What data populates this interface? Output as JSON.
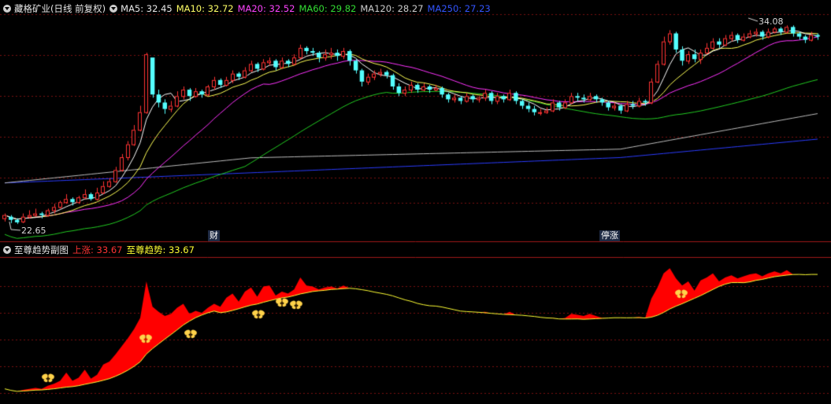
{
  "main_header": {
    "title": "藏格矿业(日线 前复权)",
    "ma": [
      {
        "label": "MA5: 32.45",
        "color": "#e8e8e8"
      },
      {
        "label": "MA10: 32.72",
        "color": "#ffff66"
      },
      {
        "label": "MA20: 32.52",
        "color": "#ff44ff"
      },
      {
        "label": "MA60: 29.82",
        "color": "#33dd33"
      },
      {
        "label": "MA120: 28.27",
        "color": "#cccccc"
      },
      {
        "label": "MA250: 27.23",
        "color": "#3355ff"
      }
    ]
  },
  "annotations": {
    "high_label": "34.08",
    "low_label": "22.65",
    "event_cai": "财",
    "event_tingzhang": "停涨"
  },
  "sub_header": {
    "title": "至尊趋势副图",
    "items": [
      {
        "label": "上涨: 33.67",
        "color": "#ff3333"
      },
      {
        "label": "至尊趋势: 33.67",
        "color": "#ffff33"
      }
    ]
  },
  "colors": {
    "up": "#ff3333",
    "down": "#54ffff",
    "grid": "#7a1010",
    "trend_fill": "#ff0000",
    "trend_line": "#ffff33",
    "butterfly": "#ffd24a"
  },
  "chart_data": {
    "type": "candlestick",
    "ohlc_note": "approximate daily prices read from the chart, open/close/high/low",
    "candles": [
      [
        23.0,
        23.2,
        23.3,
        22.8
      ],
      [
        23.1,
        22.9,
        23.2,
        22.7
      ],
      [
        22.9,
        22.75,
        23.0,
        22.65
      ],
      [
        22.8,
        23.1,
        23.3,
        22.7
      ],
      [
        23.1,
        23.2,
        23.5,
        23.0
      ],
      [
        23.2,
        23.3,
        23.6,
        23.1
      ],
      [
        23.3,
        23.2,
        23.4,
        23.0
      ],
      [
        23.2,
        23.5,
        23.6,
        23.1
      ],
      [
        23.5,
        23.7,
        23.9,
        23.3
      ],
      [
        23.7,
        24.0,
        24.1,
        23.6
      ],
      [
        24.0,
        24.2,
        24.5,
        23.9
      ],
      [
        24.2,
        24.0,
        24.3,
        23.8
      ],
      [
        24.0,
        24.3,
        24.4,
        23.9
      ],
      [
        24.3,
        24.5,
        24.8,
        24.2
      ],
      [
        24.5,
        24.2,
        24.6,
        24.1
      ],
      [
        24.2,
        24.6,
        24.9,
        24.1
      ],
      [
        24.6,
        25.0,
        25.3,
        24.5
      ],
      [
        25.0,
        25.3,
        25.5,
        24.9
      ],
      [
        25.3,
        26.0,
        26.2,
        25.2
      ],
      [
        26.0,
        26.8,
        27.0,
        25.9
      ],
      [
        26.8,
        27.6,
        27.8,
        26.6
      ],
      [
        27.6,
        28.5,
        28.8,
        27.5
      ],
      [
        28.5,
        29.6,
        30.0,
        28.4
      ],
      [
        29.6,
        33.2,
        33.3,
        29.5
      ],
      [
        33.0,
        30.7,
        31.5,
        30.5
      ],
      [
        30.7,
        30.2,
        31.0,
        29.9
      ],
      [
        30.2,
        29.8,
        30.4,
        29.5
      ],
      [
        29.8,
        30.0,
        30.3,
        29.6
      ],
      [
        30.0,
        30.6,
        30.9,
        29.9
      ],
      [
        30.6,
        31.0,
        31.2,
        30.4
      ],
      [
        31.0,
        30.6,
        31.1,
        30.3
      ],
      [
        30.6,
        30.9,
        31.1,
        30.5
      ],
      [
        30.9,
        30.7,
        31.0,
        30.5
      ],
      [
        30.7,
        31.2,
        31.3,
        30.6
      ],
      [
        31.2,
        31.6,
        31.8,
        31.0
      ],
      [
        31.6,
        31.3,
        31.7,
        31.1
      ],
      [
        31.3,
        31.6,
        31.8,
        31.2
      ],
      [
        31.6,
        32.0,
        32.2,
        31.4
      ],
      [
        32.0,
        31.8,
        32.1,
        31.6
      ],
      [
        31.8,
        32.2,
        32.4,
        31.7
      ],
      [
        32.2,
        32.6,
        32.8,
        32.1
      ],
      [
        32.6,
        32.3,
        32.7,
        32.1
      ],
      [
        32.3,
        32.7,
        32.9,
        32.2
      ],
      [
        32.7,
        32.8,
        33.0,
        32.5
      ],
      [
        32.8,
        32.4,
        32.9,
        32.2
      ],
      [
        32.4,
        32.8,
        33.0,
        32.3
      ],
      [
        32.8,
        32.6,
        32.9,
        32.4
      ],
      [
        32.6,
        33.0,
        33.2,
        32.5
      ],
      [
        33.0,
        33.6,
        33.8,
        32.9
      ],
      [
        33.6,
        33.4,
        33.7,
        33.2
      ],
      [
        33.4,
        33.3,
        33.6,
        33.1
      ],
      [
        33.3,
        33.0,
        33.4,
        32.7
      ],
      [
        33.0,
        33.2,
        33.5,
        32.8
      ],
      [
        33.2,
        33.3,
        33.6,
        32.9
      ],
      [
        33.3,
        33.1,
        33.5,
        32.8
      ],
      [
        33.1,
        33.4,
        33.6,
        32.9
      ],
      [
        33.4,
        32.8,
        33.5,
        32.5
      ],
      [
        32.8,
        32.2,
        32.9,
        32.0
      ],
      [
        32.2,
        31.5,
        32.3,
        31.2
      ],
      [
        31.5,
        31.8,
        32.0,
        31.3
      ],
      [
        31.8,
        32.0,
        32.2,
        31.6
      ],
      [
        32.0,
        32.1,
        32.3,
        31.8
      ],
      [
        32.1,
        31.9,
        32.2,
        31.7
      ],
      [
        31.9,
        31.2,
        32.0,
        31.0
      ],
      [
        31.2,
        30.8,
        31.4,
        30.6
      ],
      [
        30.8,
        31.0,
        31.2,
        30.6
      ],
      [
        31.0,
        31.3,
        31.5,
        30.8
      ],
      [
        31.3,
        31.0,
        31.4,
        30.8
      ],
      [
        31.0,
        31.2,
        31.4,
        30.9
      ],
      [
        31.2,
        31.0,
        31.3,
        30.8
      ],
      [
        31.0,
        31.1,
        31.3,
        30.9
      ],
      [
        31.1,
        30.7,
        31.2,
        30.5
      ],
      [
        30.7,
        30.4,
        30.8,
        30.2
      ],
      [
        30.4,
        30.5,
        30.7,
        30.2
      ],
      [
        30.5,
        30.3,
        30.6,
        30.1
      ],
      [
        30.3,
        30.6,
        30.8,
        30.2
      ],
      [
        30.6,
        30.4,
        30.7,
        30.2
      ],
      [
        30.4,
        30.5,
        30.6,
        30.2
      ],
      [
        30.5,
        30.8,
        31.0,
        30.3
      ],
      [
        30.8,
        30.3,
        30.9,
        30.1
      ],
      [
        30.3,
        30.6,
        30.8,
        30.1
      ],
      [
        30.6,
        30.4,
        30.7,
        30.2
      ],
      [
        30.4,
        30.8,
        31.0,
        30.3
      ],
      [
        30.8,
        30.3,
        30.9,
        30.1
      ],
      [
        30.3,
        30.0,
        30.4,
        29.8
      ],
      [
        30.0,
        29.8,
        30.2,
        29.6
      ],
      [
        29.8,
        29.6,
        30.0,
        29.4
      ],
      [
        29.6,
        29.6,
        29.8,
        29.4
      ],
      [
        29.6,
        29.7,
        29.9,
        29.5
      ],
      [
        29.7,
        30.2,
        30.4,
        29.6
      ],
      [
        30.2,
        29.9,
        30.3,
        29.7
      ],
      [
        29.9,
        30.2,
        30.4,
        29.8
      ],
      [
        30.2,
        30.6,
        30.8,
        30.1
      ],
      [
        30.6,
        30.5,
        30.8,
        30.3
      ],
      [
        30.5,
        30.4,
        30.7,
        30.2
      ],
      [
        30.4,
        30.6,
        30.8,
        30.3
      ],
      [
        30.6,
        30.4,
        30.7,
        30.2
      ],
      [
        30.4,
        30.2,
        30.5,
        30.0
      ],
      [
        30.2,
        29.9,
        30.3,
        29.7
      ],
      [
        29.9,
        30.0,
        30.2,
        29.7
      ],
      [
        30.0,
        29.7,
        30.1,
        29.5
      ],
      [
        29.7,
        30.1,
        30.3,
        29.6
      ],
      [
        30.1,
        30.0,
        30.3,
        29.8
      ],
      [
        30.0,
        30.3,
        30.5,
        29.9
      ],
      [
        30.3,
        30.2,
        30.4,
        30.0
      ],
      [
        30.2,
        31.5,
        31.7,
        30.1
      ],
      [
        31.5,
        32.6,
        32.8,
        31.4
      ],
      [
        32.6,
        34.0,
        34.3,
        32.5
      ],
      [
        34.0,
        34.5,
        34.7,
        33.8
      ],
      [
        34.5,
        33.5,
        34.6,
        33.3
      ],
      [
        33.5,
        32.8,
        33.7,
        32.5
      ],
      [
        32.8,
        33.2,
        33.4,
        32.6
      ],
      [
        33.2,
        32.9,
        33.5,
        32.7
      ],
      [
        32.9,
        33.3,
        33.5,
        32.6
      ],
      [
        33.3,
        33.6,
        33.9,
        33.2
      ],
      [
        33.6,
        34.0,
        34.2,
        33.5
      ],
      [
        34.0,
        33.8,
        34.2,
        33.6
      ],
      [
        33.8,
        34.2,
        34.4,
        33.7
      ],
      [
        34.2,
        34.4,
        34.6,
        34.0
      ],
      [
        34.4,
        34.1,
        34.5,
        33.9
      ],
      [
        34.1,
        34.3,
        34.5,
        34.0
      ],
      [
        34.3,
        34.5,
        34.7,
        34.2
      ],
      [
        34.5,
        34.6,
        34.8,
        34.3
      ],
      [
        34.6,
        34.3,
        34.7,
        34.1
      ],
      [
        34.3,
        34.6,
        34.8,
        34.2
      ],
      [
        34.6,
        34.8,
        34.9,
        34.5
      ],
      [
        34.8,
        34.6,
        34.9,
        34.4
      ],
      [
        34.6,
        34.9,
        35.0,
        34.5
      ],
      [
        34.9,
        34.5,
        35.0,
        34.3
      ],
      [
        34.5,
        34.3,
        34.6,
        34.1
      ],
      [
        34.3,
        34.1,
        34.4,
        33.9
      ],
      [
        34.1,
        34.4,
        34.6,
        34.0
      ],
      [
        34.4,
        34.3,
        34.5,
        34.1
      ]
    ]
  }
}
